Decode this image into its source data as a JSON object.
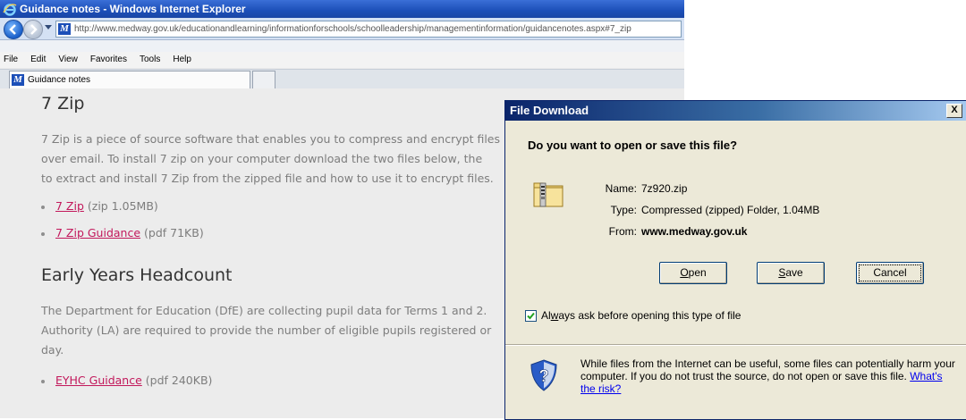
{
  "browser": {
    "window_title": "Guidance notes - Windows Internet Explorer",
    "url": "http://www.medway.gov.uk/educationandlearning/informationforschools/schoolleadership/managementinformation/guidancenotes.aspx#7_zip",
    "menu": [
      "File",
      "Edit",
      "View",
      "Favorites",
      "Tools",
      "Help"
    ],
    "tab_title": "Guidance notes"
  },
  "content": {
    "section1": {
      "heading": "7 Zip",
      "lines": [
        "7 Zip is a piece of source software that enables you to compress and encrypt files",
        "over email. To install 7 zip on your computer download the two files below, the",
        "to extract and install 7 Zip from the zipped file and how to use it to encrypt files."
      ],
      "links": [
        {
          "text": "7 Zip",
          "meta": "(zip 1.05MB)"
        },
        {
          "text": "7 Zip Guidance",
          "meta": "(pdf 71KB)"
        }
      ]
    },
    "section2": {
      "heading": "Early Years Headcount",
      "lines": [
        "The Department for Education (DfE) are collecting pupil data for Terms 1 and 2.",
        "Authority (LA) are required to provide the number of eligible pupils registered or",
        "day."
      ],
      "links": [
        {
          "text": "EYHC Guidance",
          "meta": "(pdf 240KB)"
        }
      ]
    }
  },
  "dialog": {
    "title": "File Download",
    "close": "X",
    "question": "Do you want to open or save this file?",
    "name_label": "Name:",
    "name_value": "7z920.zip",
    "type_label": "Type:",
    "type_value": "Compressed (zipped) Folder, 1.04MB",
    "from_label": "From:",
    "from_value": "www.medway.gov.uk",
    "open_pre": "",
    "open_acc": "O",
    "open_post": "pen",
    "save_pre": "",
    "save_acc": "S",
    "save_post": "ave",
    "cancel": "Cancel",
    "checkbox_checked": true,
    "checkbox_pre": "Al",
    "checkbox_acc": "w",
    "checkbox_post": "ays ask before opening this type of file",
    "warning": "While files from the Internet can be useful, some files can potentially harm your computer. If you do not trust the source, do not open or save this file.",
    "risk_link": "What's the risk?"
  },
  "icons": {
    "ie_logo": "ie-icon",
    "site_logo": "medway-icon",
    "folder": "zip-folder-icon",
    "shield": "security-shield-icon"
  }
}
